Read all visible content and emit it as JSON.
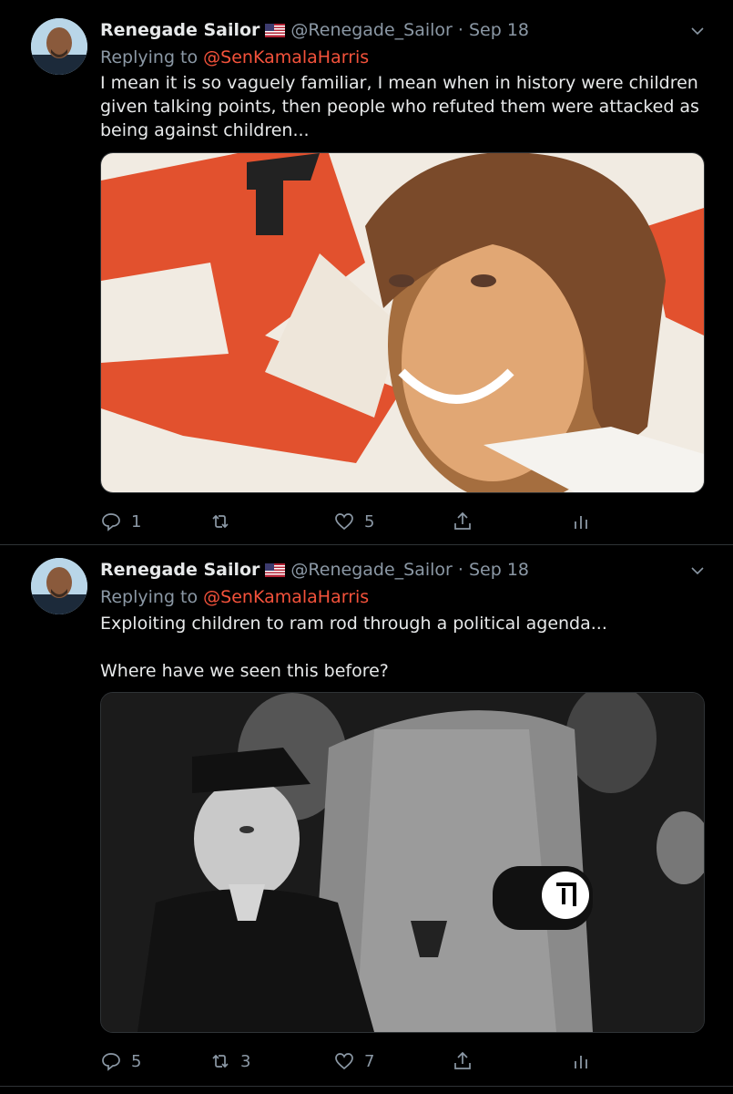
{
  "tweets": [
    {
      "author": "Renegade Sailor",
      "handle": "@Renegade_Sailor",
      "date": "Sep 18",
      "replying_prefix": "Replying to",
      "replying_to": "@SenKamalaHarris",
      "text": "I mean it is so vaguely familiar, I mean when in history were children given talking points, then people who refuted them were attacked as being against children...",
      "replies": "1",
      "retweets": "",
      "likes": "5"
    },
    {
      "author": "Renegade Sailor",
      "handle": "@Renegade_Sailor",
      "date": "Sep 18",
      "replying_prefix": "Replying to",
      "replying_to": "@SenKamalaHarris",
      "text_line1": "Exploiting children to ram rod through a political agenda...",
      "text_line2": "Where have we seen this before?",
      "replies": "5",
      "retweets": "3",
      "likes": "7"
    }
  ],
  "icons": {
    "reply": "reply-icon",
    "retweet": "retweet-icon",
    "like": "heart-icon",
    "share": "share-icon",
    "stats": "analytics-icon",
    "caret": "chevron-down-icon"
  },
  "colors": {
    "background": "#000000",
    "mention": "#f4523b",
    "secondary_text": "#8b98a5",
    "primary_text": "#e7e9ea"
  }
}
